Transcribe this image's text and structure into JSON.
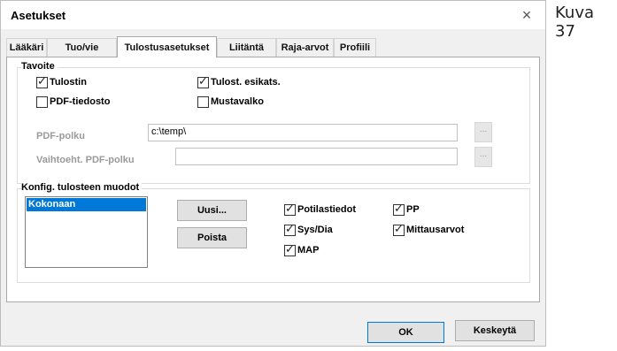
{
  "window": {
    "title": "Asetukset",
    "close_glyph": "×"
  },
  "caption": "Kuva 37",
  "tabs": [
    {
      "label": "Lääkäri"
    },
    {
      "label": "Tuo/vie"
    },
    {
      "label": "Tulostusasetukset",
      "active": true
    },
    {
      "label": "Liitäntä"
    },
    {
      "label": "Raja-arvot"
    },
    {
      "label": "Profiili"
    }
  ],
  "target_group": {
    "label": "Tavoite",
    "options": [
      {
        "label": "Tulostin",
        "checked": true
      },
      {
        "label": "Tulost. esikats.",
        "checked": true
      },
      {
        "label": "PDF-tiedosto",
        "checked": false
      },
      {
        "label": "Mustavalko",
        "checked": false
      }
    ],
    "pdf_path_label": "PDF-polku",
    "pdf_path_value": "c:\\temp\\",
    "alt_pdf_path_label": "Vaihtoeht. PDF-polku",
    "alt_pdf_path_value": "",
    "browse_label": "..."
  },
  "formats_group": {
    "label": "Konfig. tulosteen muodot",
    "list_items": [
      "Kokonaan"
    ],
    "new_button": "Uusi...",
    "delete_button": "Poista",
    "options": [
      {
        "label": "Potilastiedot",
        "checked": true
      },
      {
        "label": "PP",
        "checked": true
      },
      {
        "label": "Sys/Dia",
        "checked": true
      },
      {
        "label": "Mittausarvot",
        "checked": true
      },
      {
        "label": "MAP",
        "checked": true
      }
    ]
  },
  "footer": {
    "ok_label": "OK",
    "cancel_label": "Keskeytä"
  },
  "check_glyph": "✓"
}
